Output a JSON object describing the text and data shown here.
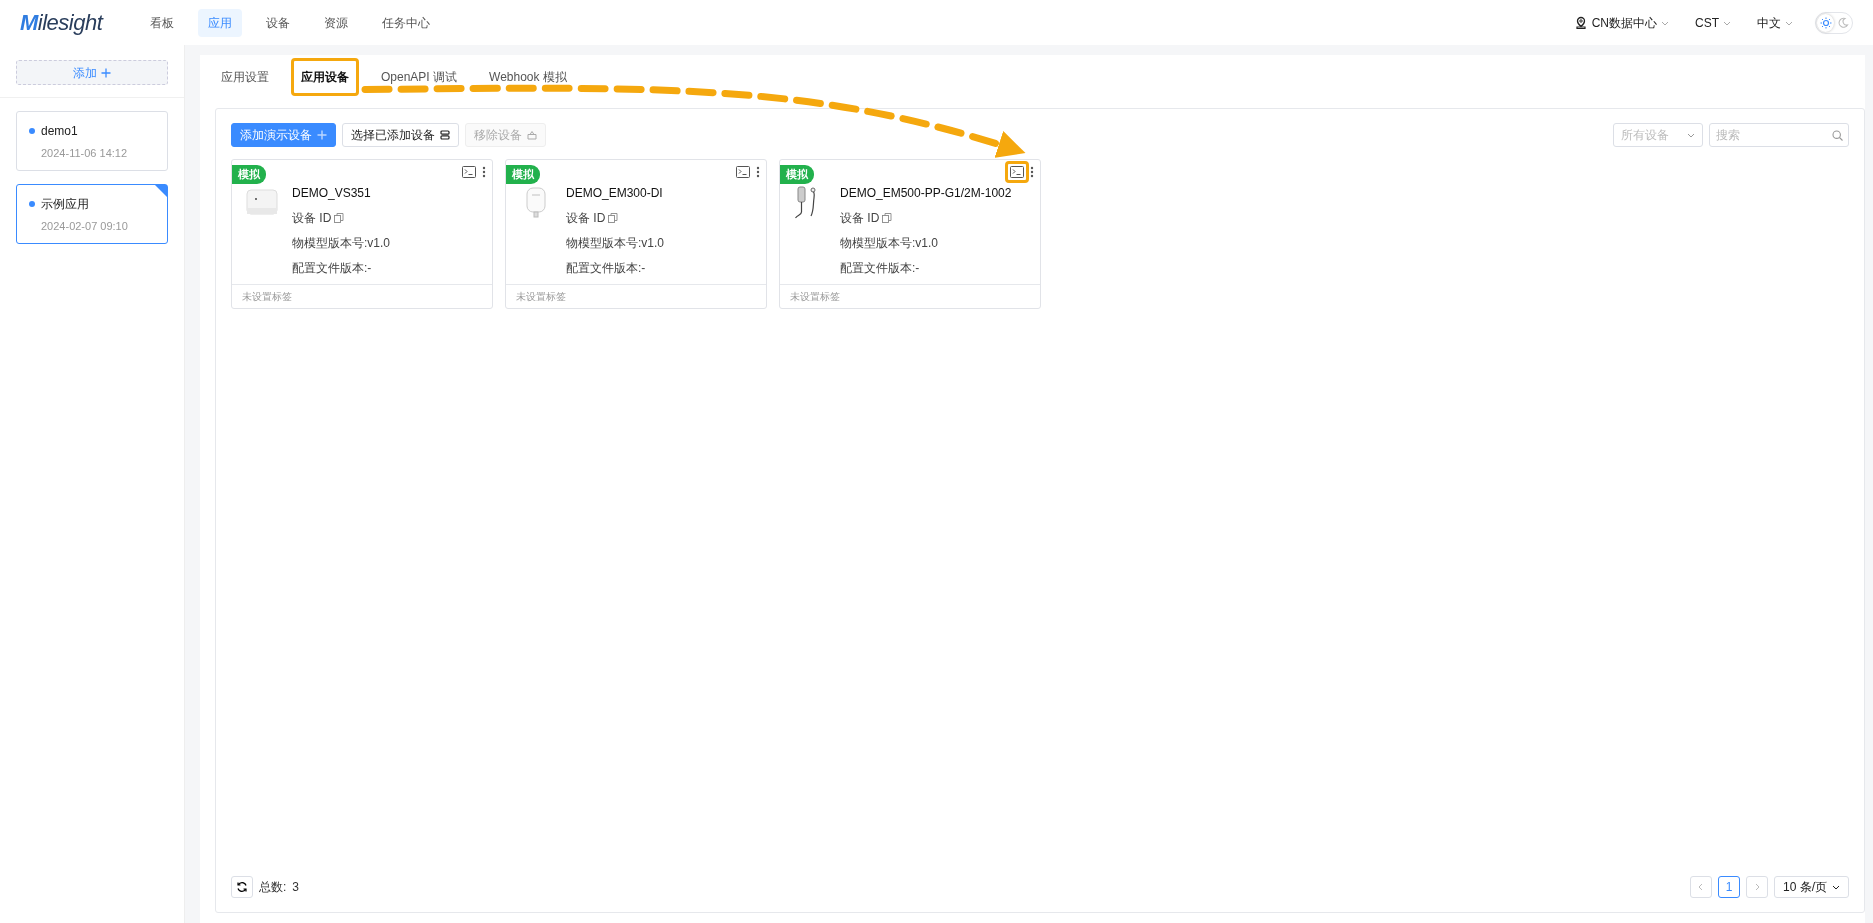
{
  "logo": "Milesight",
  "nav": [
    {
      "label": "看板",
      "selected": false
    },
    {
      "label": "应用",
      "selected": true
    },
    {
      "label": "设备",
      "selected": false
    },
    {
      "label": "资源",
      "selected": false
    },
    {
      "label": "任务中心",
      "selected": false
    }
  ],
  "header": {
    "datacenter": "CN数据中心",
    "timezone": "CST",
    "language": "中文",
    "dark_mode": false
  },
  "sidebar": {
    "add_button": "添加",
    "apps": [
      {
        "name": "demo1",
        "time": "2024-11-06 14:12",
        "selected": false
      },
      {
        "name": "示例应用",
        "time": "2024-02-07 09:10",
        "selected": true
      }
    ]
  },
  "tabs": [
    {
      "label": "应用设置",
      "selected": false,
      "highlighted": false
    },
    {
      "label": "应用设备",
      "selected": true,
      "highlighted": true
    },
    {
      "label": "OpenAPI 调试",
      "selected": false,
      "highlighted": false
    },
    {
      "label": "Webhook 模拟",
      "selected": false,
      "highlighted": false
    }
  ],
  "toolbar": {
    "buttons": [
      {
        "label": "添加演示设备",
        "kind": "primary",
        "disabled": false
      },
      {
        "label": "选择已添加设备",
        "kind": "select",
        "disabled": false
      },
      {
        "label": "移除设备",
        "kind": "remove",
        "disabled": true
      }
    ],
    "filter": "所有设备",
    "search": {
      "placeholder": "搜索"
    }
  },
  "devices": [
    {
      "badge": "模拟",
      "name": "DEMO_VS351",
      "id_label": "设备 ID",
      "model_version": "物模型版本号:v1.0",
      "config_version": "配置文件版本:-",
      "tags": "未设置标签",
      "kind": "box",
      "highlighted": false
    },
    {
      "badge": "模拟",
      "name": "DEMO_EM300-DI",
      "id_label": "设备 ID",
      "model_version": "物模型版本号:v1.0",
      "config_version": "配置文件版本:-",
      "tags": "未设置标签",
      "kind": "plug",
      "highlighted": false
    },
    {
      "badge": "模拟",
      "name": "DEMO_EM500-PP-G1/2M-1002",
      "id_label": "设备 ID",
      "model_version": "物模型版本号:v1.0",
      "config_version": "配置文件版本:-",
      "tags": "未设置标签",
      "kind": "probe",
      "highlighted": true
    }
  ],
  "footer": {
    "total_label": "总数:",
    "total": "3",
    "pages": [
      {
        "label": "1",
        "selected": true
      }
    ],
    "page_size": "10 条/页"
  }
}
